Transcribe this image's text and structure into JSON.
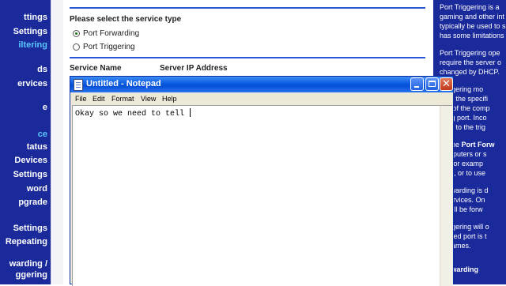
{
  "left_nav": {
    "items": [
      {
        "label": "ttings"
      },
      {
        "label": "Settings"
      },
      {
        "label": "iltering",
        "active": true
      },
      {
        "label": "ds"
      },
      {
        "label": "ervices"
      },
      {
        "label": "e"
      },
      {
        "label": "ce",
        "active": true
      },
      {
        "label": "tatus"
      },
      {
        "label": "Devices"
      },
      {
        "label": "Settings"
      },
      {
        "label": "word"
      },
      {
        "label": "pgrade"
      },
      {
        "label": "Settings"
      },
      {
        "label": "Repeating"
      },
      {
        "label": "warding /"
      },
      {
        "label": "ggering"
      }
    ]
  },
  "main": {
    "service_heading": "Please select the service type",
    "options": [
      {
        "label": "Port Forwarding",
        "checked": true
      },
      {
        "label": "Port Triggering",
        "checked": false
      }
    ],
    "columns": [
      "Service Name",
      "Server IP Address"
    ]
  },
  "help_panel": {
    "lines": [
      {
        "text": "Port Triggering is a"
      },
      {
        "text": "gaming and other int"
      },
      {
        "text": "typically be used to s"
      },
      {
        "text": "has some limitations"
      },
      {
        "text": "Port Triggering ope"
      },
      {
        "text": "require the server o"
      },
      {
        "text": "changed by DHCP."
      },
      {
        "text": "Triggering mo"
      },
      {
        "text": "rt on the specifi"
      },
      {
        "text": "ess of the comp"
      },
      {
        "text": "ming port. Inco"
      },
      {
        "text": "rded to the trig"
      },
      {
        "text": "ng the ",
        "bold_part": "Port Forw"
      },
      {
        "text": "computers or s"
      },
      {
        "text": "es (for examp"
      },
      {
        "text": "e III), or to use"
      },
      {
        "text": "Forwarding is d"
      },
      {
        "text": "d services. On"
      },
      {
        "text": "et will be forw"
      },
      {
        "text": "Triggering will o"
      },
      {
        "text": "gnated port is t"
      },
      {
        "text": "et games."
      },
      {
        "text": "",
        "bold_part": "Forwarding"
      }
    ]
  },
  "notepad": {
    "title": "Untitled - Notepad",
    "menu": [
      "File",
      "Edit",
      "Format",
      "View",
      "Help"
    ],
    "content": "Okay so we need to tell "
  },
  "colors": {
    "nav_blue": "#1a2a9a",
    "active_link": "#5ac8ff",
    "xp_title_blue": "#0a5ae0"
  },
  "icons": [
    "notepad-icon",
    "minimize-icon",
    "maximize-icon",
    "close-icon"
  ]
}
